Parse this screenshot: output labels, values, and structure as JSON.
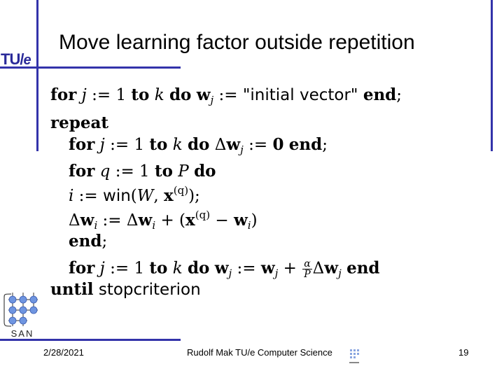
{
  "header": {
    "logo_text": "TU/",
    "logo_text_e": "e",
    "title": "Move learning factor outside repetition"
  },
  "algorithm": {
    "line1": {
      "for": "for",
      "j": "j",
      "assign": " := 1 ",
      "to": "to",
      "k": "k",
      "do": "do",
      "w": "w",
      "sub": "j",
      "assign2": " := ",
      "initial": "\"initial vector\"",
      "end": "end",
      "semi": ";"
    },
    "line2": {
      "repeat": "repeat"
    },
    "line3": {
      "for": "for",
      "j": "j",
      "assign": " := 1 ",
      "to": "to",
      "k": "k",
      "do": "do",
      "delta": "Δ",
      "w": "w",
      "sub": "j",
      "assign2": " := ",
      "zero": "0",
      "end": "end",
      "semi": ";"
    },
    "line4": {
      "for": "for",
      "q": "q",
      "assign": " := 1 ",
      "to": "to",
      "P": "P",
      "do": "do"
    },
    "line5": {
      "i": "i",
      "assign": " := ",
      "win": "win",
      "open": "(",
      "W": "W",
      "comma": ", ",
      "x": "x",
      "sup": "(q)",
      "close": ");"
    },
    "line6": {
      "delta": "Δ",
      "w": "w",
      "sub": "i",
      "assign": " := ",
      "delta2": "Δ",
      "w2": "w",
      "sub2": "i",
      "plus": " + (",
      "x": "x",
      "sup": "(q)",
      "minus": " − ",
      "w3": "w",
      "sub3": "i",
      "close": ")"
    },
    "line7": {
      "end": "end",
      "semi": ";"
    },
    "line8": {
      "for": "for",
      "j": "j",
      "assign": " := 1 ",
      "to": "to",
      "k": "k",
      "do": "do",
      "w": "w",
      "sub": "j",
      "assign2": " := ",
      "w2": "w",
      "sub2": "j",
      "plus": " + ",
      "alpha": "α",
      "P": "P",
      "delta": "Δ",
      "w3": "w",
      "sub3": "j",
      "end": "end"
    },
    "line9": {
      "until": "until",
      "criterion": "stopcriterion"
    }
  },
  "footer": {
    "date": "2/28/2021",
    "author": "Rudolf Mak TU/e Computer Science",
    "page": "19",
    "logo_label": "SAN"
  },
  "colors": {
    "accent_line": "#3333aa",
    "logo_node": "#6f95e0"
  }
}
